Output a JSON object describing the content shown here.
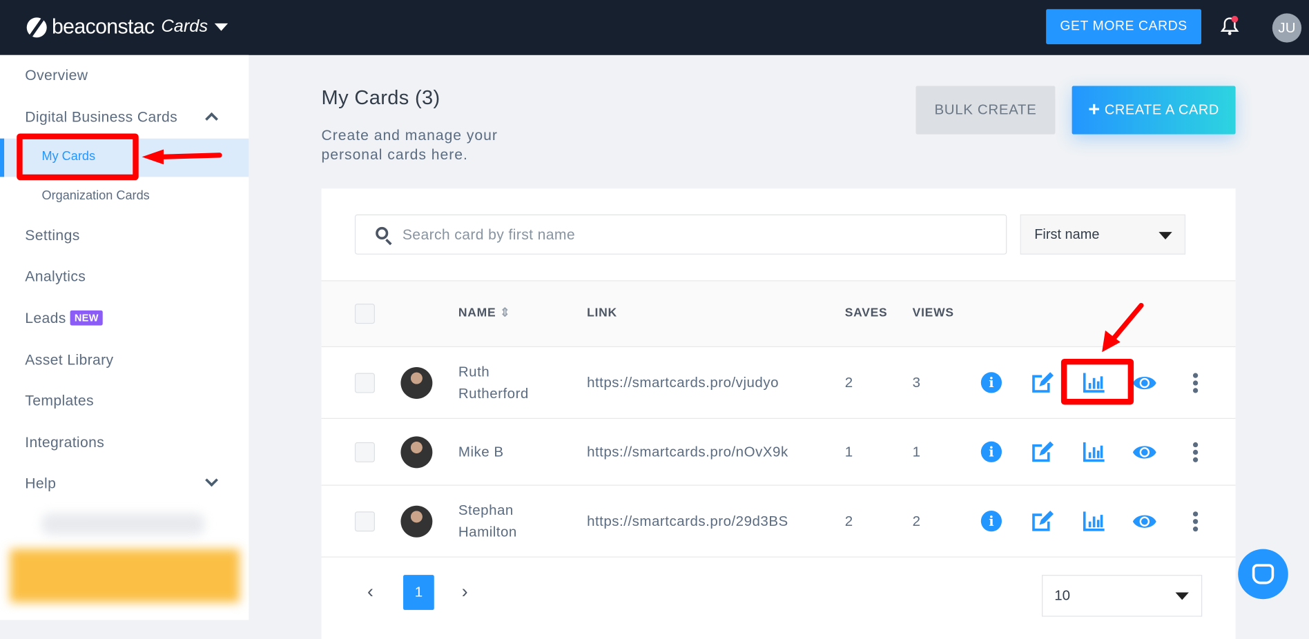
{
  "header": {
    "brand": "beaconstac",
    "product": "Cards",
    "get_more_label": "GET MORE CARDS",
    "avatar_initials": "JU"
  },
  "sidebar": {
    "items": [
      {
        "label": "Overview"
      },
      {
        "label": "Digital Business Cards"
      },
      {
        "label": "My Cards"
      },
      {
        "label": "Organization Cards"
      },
      {
        "label": "Settings"
      },
      {
        "label": "Analytics"
      },
      {
        "label": "Leads",
        "badge": "NEW"
      },
      {
        "label": "Asset Library"
      },
      {
        "label": "Templates"
      },
      {
        "label": "Integrations"
      },
      {
        "label": "Help"
      }
    ]
  },
  "main": {
    "title": "My Cards (3)",
    "subtitle": "Create and manage your personal cards here.",
    "bulk_create": "BULK CREATE",
    "create_card": "CREATE A CARD",
    "search_placeholder": "Search card by first name",
    "sort_select": "First name",
    "columns": {
      "name": "NAME",
      "link": "LINK",
      "saves": "SAVES",
      "views": "VIEWS"
    },
    "rows": [
      {
        "name": "Ruth Rutherford",
        "link": "https://smartcards.pro/vjudyo",
        "saves": "2",
        "views": "3"
      },
      {
        "name": "Mike B",
        "link": "https://smartcards.pro/nOvX9k",
        "saves": "1",
        "views": "1"
      },
      {
        "name": "Stephan Hamilton",
        "link": "https://smartcards.pro/29d3BS",
        "saves": "2",
        "views": "2"
      }
    ],
    "pagination": {
      "current_page": "1",
      "per_page": "10"
    }
  },
  "colors": {
    "accent": "#2496ff",
    "topbar": "#17202f",
    "annotation": "#ff0000"
  }
}
